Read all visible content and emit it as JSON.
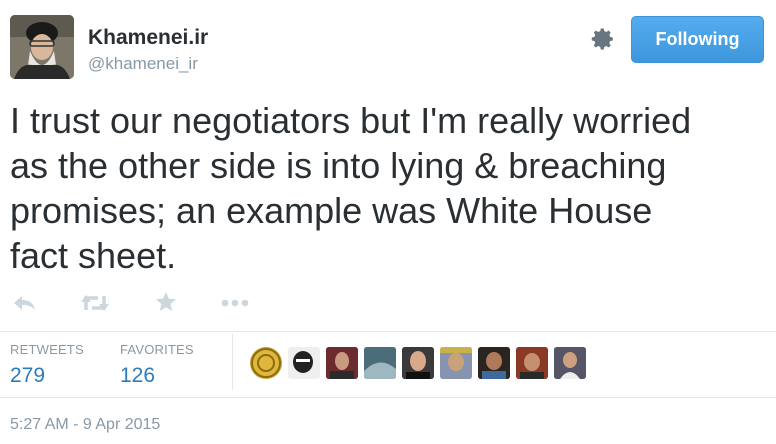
{
  "author": {
    "display_name": "Khamenei.ir",
    "username": "@khamenei_ir"
  },
  "follow_button": {
    "label": "Following"
  },
  "tweet": {
    "lines": [
      "I trust our negotiators but I'm really worried",
      "as the other side is into lying & breaching",
      "promises; an example was White House",
      "fact sheet."
    ]
  },
  "actions": [
    "reply-icon",
    "retweet-icon",
    "favorite-icon",
    "more-icon"
  ],
  "stats": {
    "retweets_label": "RETWEETS",
    "retweets_count": "279",
    "favorites_label": "FAVORITES",
    "favorites_count": "126"
  },
  "timestamp": "5:27 AM - 9 Apr 2015",
  "colors": {
    "accent": "#55acee",
    "count": "#2d7bbb",
    "muted": "#8899a6",
    "text": "#292f33",
    "action_icon": "#ccd6dd"
  }
}
